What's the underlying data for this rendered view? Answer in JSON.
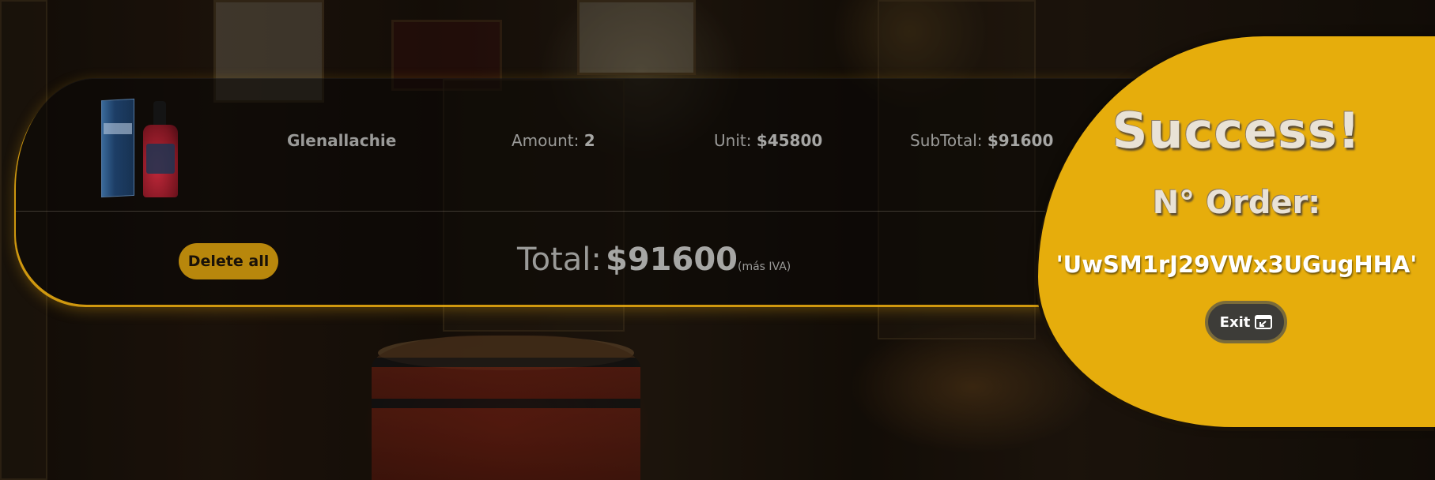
{
  "cart": {
    "items": [
      {
        "name": "Glenallachie",
        "amount_label": "Amount:",
        "amount": "2",
        "unit_label": "Unit:",
        "unit_price": "$45800",
        "subtotal_label": "SubTotal:",
        "subtotal": "$91600",
        "image_icon": "whisky-bottle-image"
      }
    ],
    "delete_all_label": "Delete all",
    "total_label": "Total:",
    "total_value": "$91600",
    "tax_note": "(más IVA)"
  },
  "modal": {
    "title": "Success!",
    "order_label": "N° Order:",
    "order_code": "'UwSM1rJ29VWx3UGugHHA'",
    "exit_label": "Exit",
    "exit_icon": "exit-window-icon"
  },
  "colors": {
    "accent": "#e6ad0c",
    "button_dim": "#b8870c",
    "exit_button": "#3d3c38"
  }
}
